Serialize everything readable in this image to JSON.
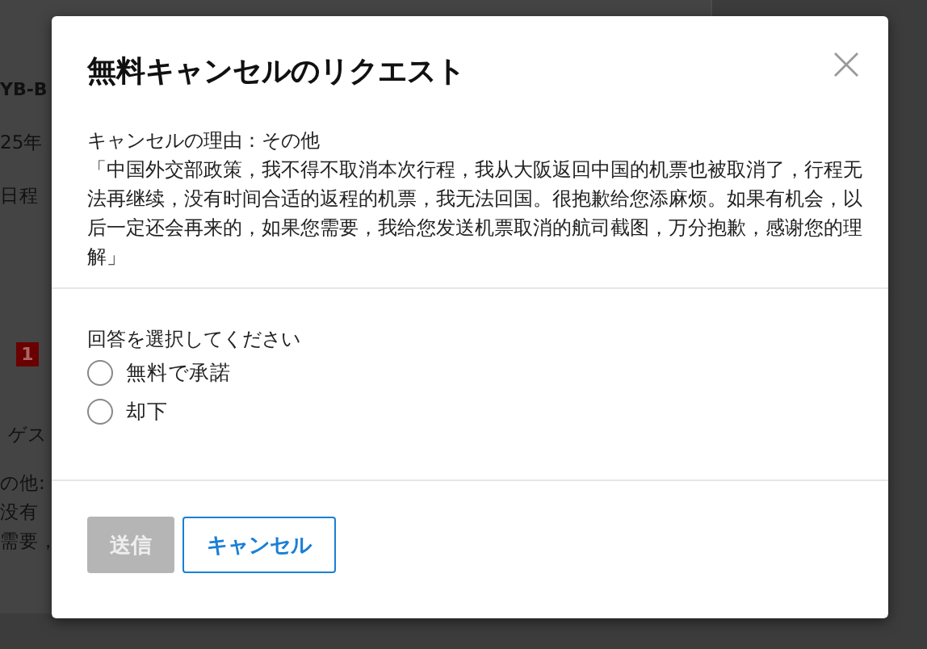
{
  "background_page": {
    "fragments": [
      "YB-B",
      "25年",
      "日程",
      "ゲス",
      "の他:",
      "没有",
      "需要，"
    ],
    "badge": "1"
  },
  "dialog": {
    "title": "無料キャンセルのリクエスト",
    "reason_label": "キャンセルの理由：その他",
    "reason_text": "「中国外交部政策，我不得不取消本次行程，我从大阪返回中国的机票也被取消了，行程无法再继续，没有时间合适的返程的机票，我无法回国。很抱歉给您添麻烦。如果有机会，以后一定还会再来的，如果您需要，我给您发送机票取消的航司截图，万分抱歉，感谢您的理解」",
    "prompt": "回答を選択してください",
    "options": [
      {
        "label": "無料で承諾",
        "selected": false
      },
      {
        "label": "却下",
        "selected": false
      }
    ],
    "buttons": [
      {
        "label": "送信",
        "kind": "primary",
        "disabled": true
      },
      {
        "label": "キャンセル",
        "kind": "secondary",
        "disabled": false
      }
    ]
  }
}
